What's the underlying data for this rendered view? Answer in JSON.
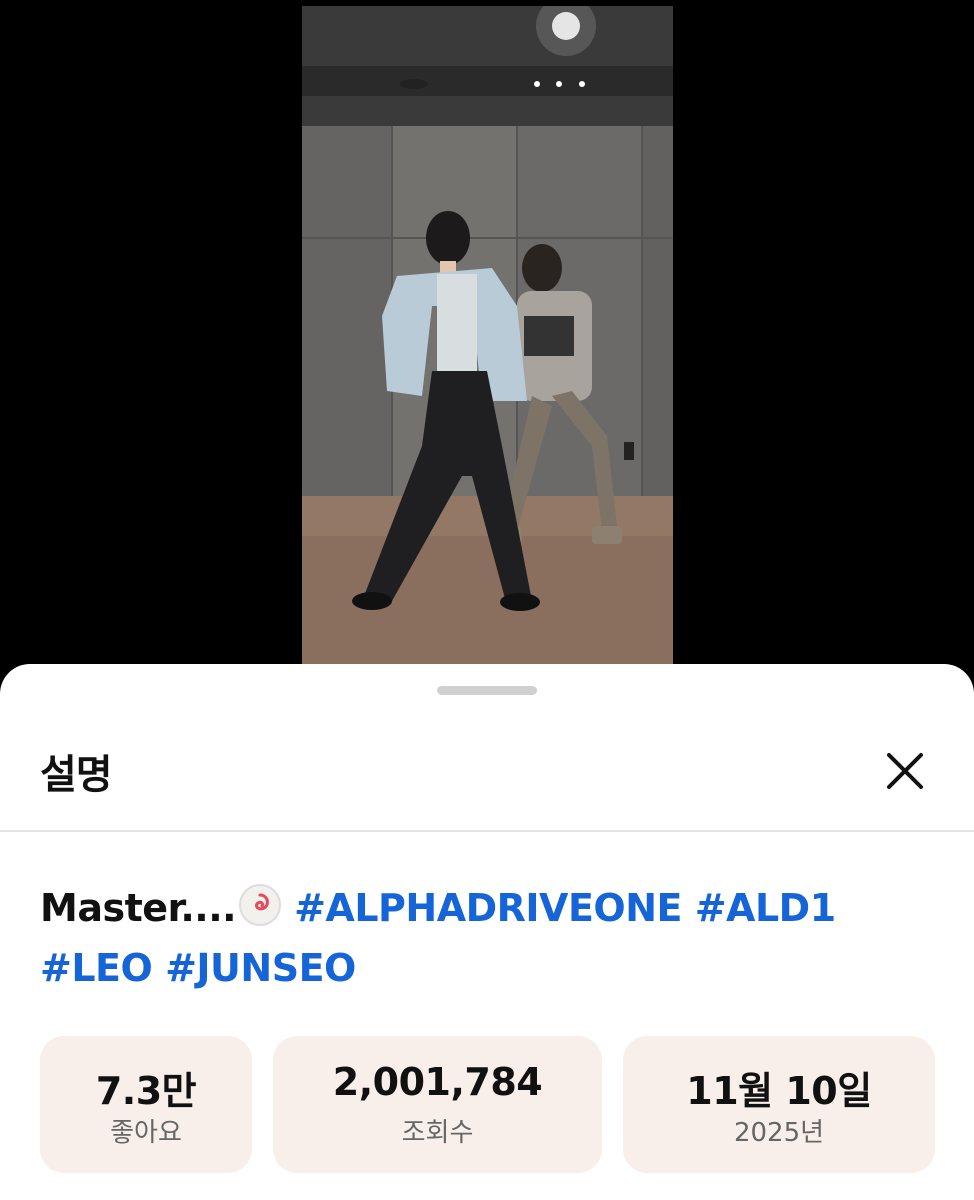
{
  "sheet": {
    "title": "설명",
    "close_icon": "close-icon"
  },
  "description": {
    "text": "Master....",
    "emoji": "fish-cake-emoji",
    "hashtags": [
      "#ALPHADRIVEONE",
      "#ALD1",
      "#LEO",
      "#JUNSEO"
    ]
  },
  "stats": {
    "likes": {
      "value": "7.3만",
      "label": "좋아요"
    },
    "views": {
      "value": "2,001,784",
      "label": "조회수"
    },
    "date": {
      "value": "11월 10일",
      "label": "2025년"
    }
  },
  "colors": {
    "hashtag": "#1565d8",
    "stat_bg": "#f8efea"
  }
}
